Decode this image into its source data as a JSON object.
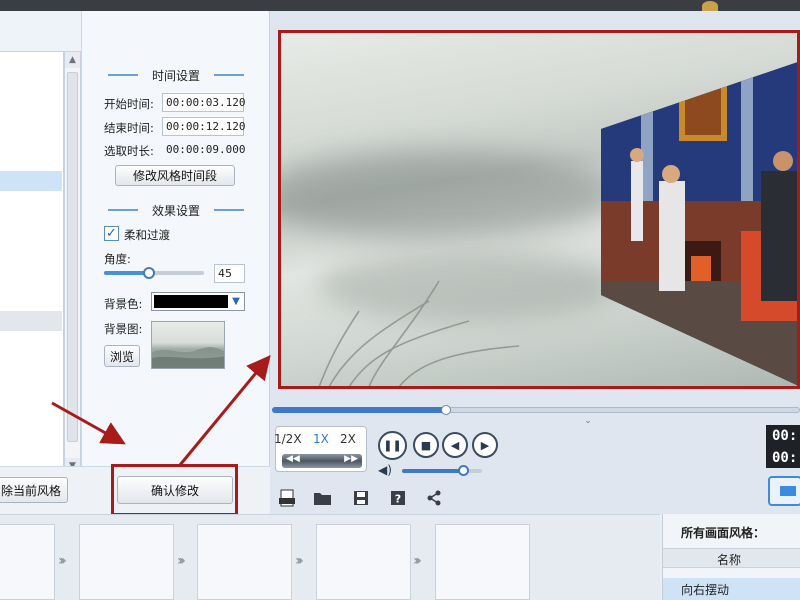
{
  "left_panel": {
    "remove_style_button": "除当前风格",
    "confirm_button": "确认修改"
  },
  "time_settings": {
    "title": "时间设置",
    "start_label": "开始时间:",
    "start_value": "00:00:03.120",
    "end_label": "结束时间:",
    "end_value": "00:00:12.120",
    "duration_label": "选取时长:",
    "duration_value": "00:00:09.000",
    "modify_button": "修改风格时间段"
  },
  "effect_settings": {
    "title": "效果设置",
    "smooth_label": "柔和过渡",
    "smooth_checked": true,
    "angle_label": "角度:",
    "angle_value": "45",
    "angle_fraction": 0.45,
    "bg_color_label": "背景色:",
    "bg_color": "#000000",
    "bg_image_label": "背景图:",
    "browse_button": "浏览"
  },
  "player": {
    "progress_fraction": 0.33,
    "speeds": [
      "1/2X",
      "1X",
      "2X"
    ],
    "active_speed": "1X",
    "volume_fraction": 0.76,
    "time_top": "00:",
    "time_bottom": "00:"
  },
  "toolbar": {
    "icons": [
      "new-icon",
      "open-folder-icon",
      "save-icon",
      "help-icon",
      "share-icon"
    ]
  },
  "style_list": {
    "header": "所有画面风格：",
    "column": "名称",
    "item": "向右摆动"
  },
  "colors": {
    "accent": "#3d79c6",
    "annotation_red": "#a71b1b",
    "selected_row": "#cfe3f7"
  }
}
